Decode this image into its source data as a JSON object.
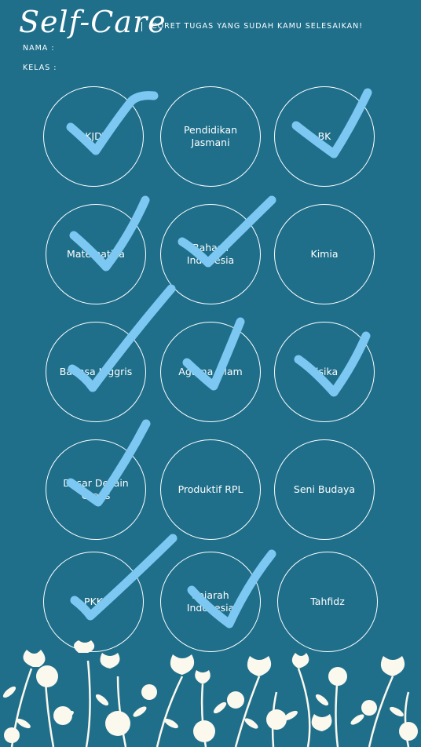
{
  "header": {
    "title": "Self-Care",
    "separator": "|",
    "instruction": "CORET TUGAS YANG SUDAH KAMU SELESAIKAN!",
    "name_label": "NAMA  :",
    "class_label": "KELAS :"
  },
  "subjects": [
    {
      "label": "PKJDT",
      "checked": true
    },
    {
      "label": "Pendidikan\nJasmani",
      "checked": false
    },
    {
      "label": "BK",
      "checked": true
    },
    {
      "label": "Matematika",
      "checked": true
    },
    {
      "label": "Bahasa Indonesia",
      "checked": true
    },
    {
      "label": "Kimia",
      "checked": false
    },
    {
      "label": "Bahasa Inggris",
      "checked": true
    },
    {
      "label": "Agama Islam",
      "checked": true
    },
    {
      "label": "Fisika",
      "checked": true
    },
    {
      "label": "Dasar Desain\nGrafis",
      "checked": true
    },
    {
      "label": "Produktif RPL",
      "checked": false
    },
    {
      "label": "Seni Budaya",
      "checked": false
    },
    {
      "label": "PKK",
      "checked": true
    },
    {
      "label": "Sejarah\nIndonesia",
      "checked": true
    },
    {
      "label": "Tahfidz",
      "checked": false
    }
  ],
  "colors": {
    "background": "#1f6f8b",
    "check": "#7cc8f2",
    "flower": "#fbf8ee"
  }
}
